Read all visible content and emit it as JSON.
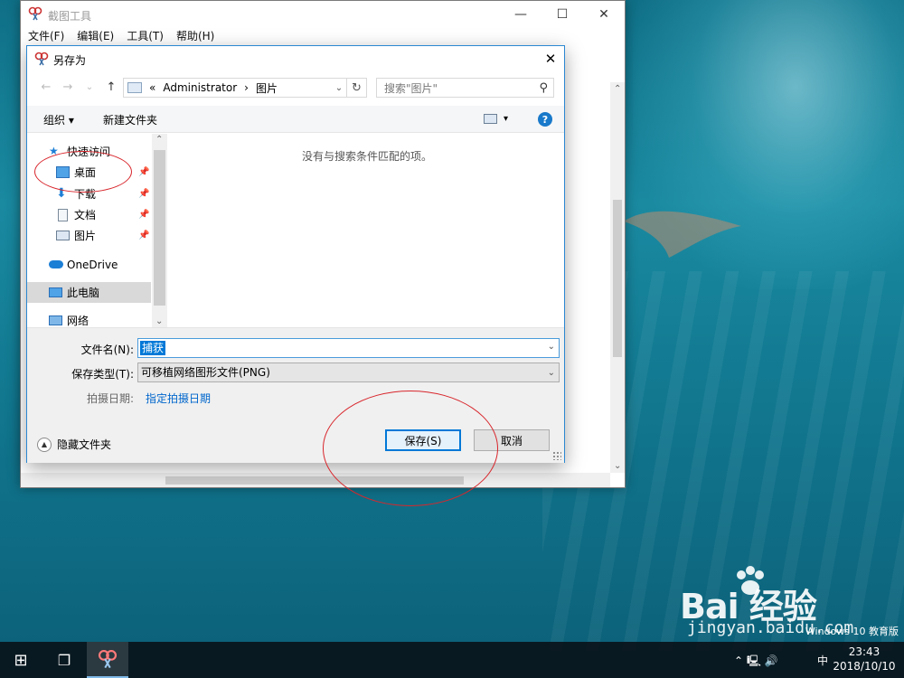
{
  "app": {
    "title": "截图工具",
    "menu": [
      "文件(F)",
      "编辑(E)",
      "工具(T)",
      "帮助(H)"
    ],
    "caption": {
      "minimize": "—",
      "maximize": "☐",
      "close": "✕"
    }
  },
  "dialog": {
    "title": "另存为",
    "close": "✕",
    "nav": {
      "back": "←",
      "forward": "→",
      "recent": "⌄",
      "up": "↑"
    },
    "address": {
      "chevrons": "«",
      "path": [
        "Administrator",
        "图片"
      ],
      "separator": "›",
      "dropdown": "⌄",
      "refresh": "↻"
    },
    "search": {
      "placeholder": "搜索\"图片\"",
      "icon": "⚲"
    },
    "toolbar": {
      "organize": "组织 ▾",
      "new_folder": "新建文件夹",
      "view_dropdown": "▾",
      "help": "?"
    },
    "nav_pane": {
      "quick_access": "快速访问",
      "items": [
        {
          "label": "桌面",
          "pinned": true
        },
        {
          "label": "下载",
          "pinned": true
        },
        {
          "label": "文档",
          "pinned": true
        },
        {
          "label": "图片",
          "pinned": true
        }
      ],
      "pin_glyph": "📌",
      "onedrive": "OneDrive",
      "this_pc": "此电脑",
      "network": "网络",
      "scroll_up": "⌃",
      "scroll_down": "⌄"
    },
    "empty_message": "没有与搜索条件匹配的项。",
    "form": {
      "filename_label": "文件名(N):",
      "filename_value": "捕获",
      "filetype_label": "保存类型(T):",
      "filetype_value": "可移植网络图形文件(PNG)",
      "date_label": "拍摄日期:",
      "date_link": "指定拍摄日期",
      "dropdown": "⌄",
      "hide_folders": "隐藏文件夹",
      "hide_glyph": "▲",
      "save": "保存(S)",
      "cancel": "取消"
    }
  },
  "taskbar": {
    "start": "⊞",
    "task_view": "❐",
    "tray_icons": "⌃  🖳  🔊",
    "ime": "中",
    "time": "23:43",
    "date": "2018/10/10"
  },
  "watermark": {
    "logo": "Bai  经验",
    "url": "jingyan.baidu.com",
    "edition": "Windows 10 教育版"
  }
}
